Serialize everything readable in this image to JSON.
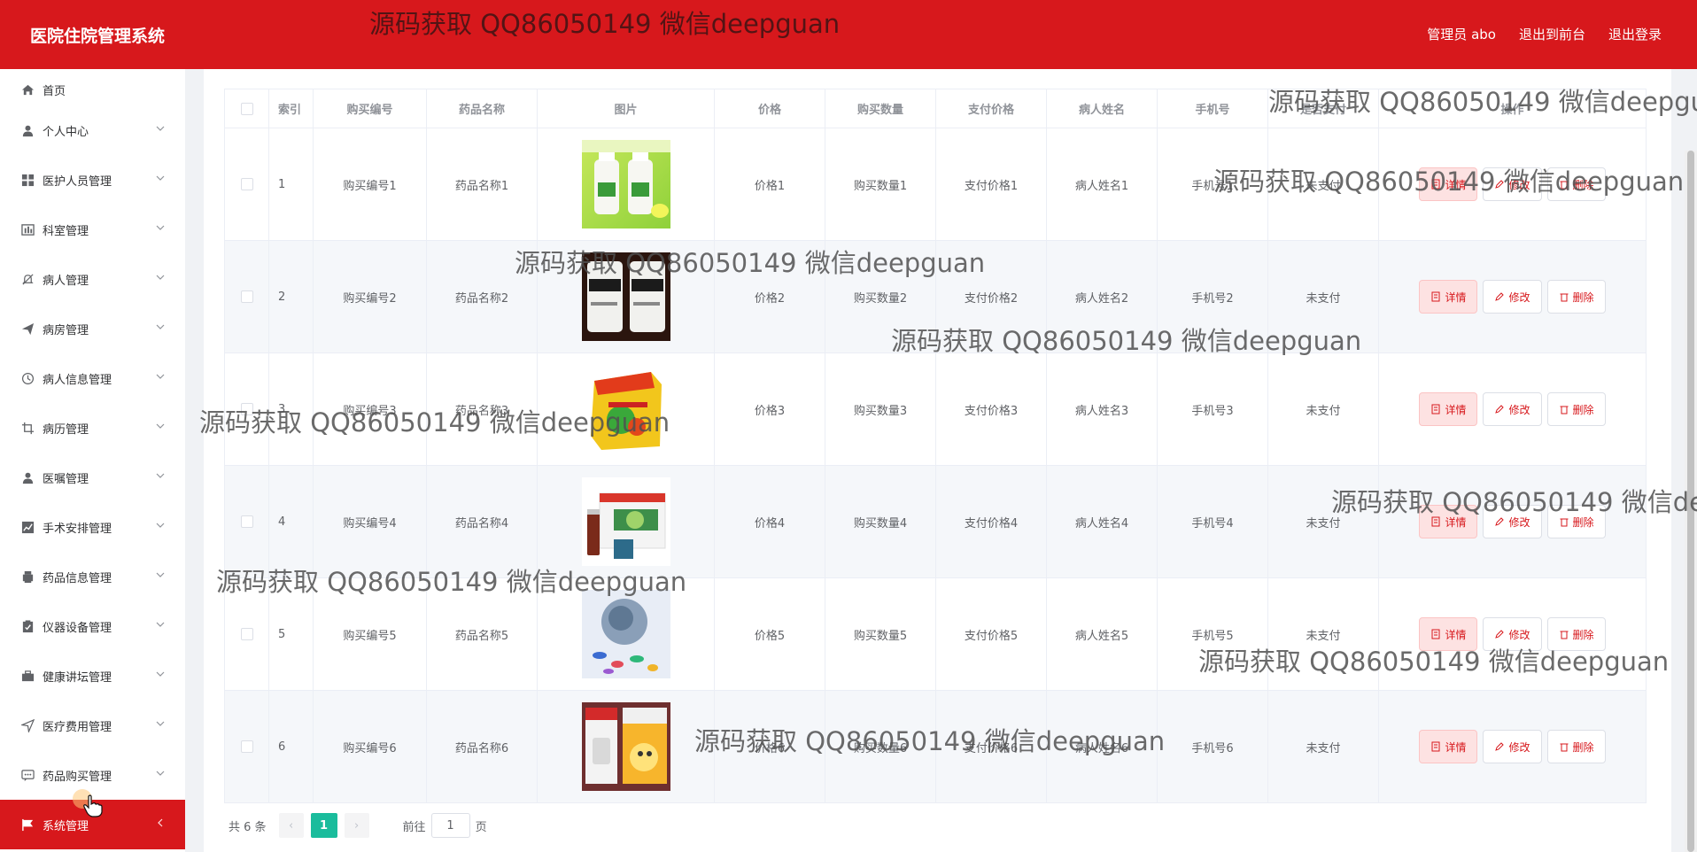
{
  "header": {
    "title": "医院住院管理系统",
    "user_label": "管理员 abo",
    "front_link": "退出到前台",
    "logout_link": "退出登录"
  },
  "sidebar": {
    "items": [
      {
        "label": "首页",
        "icon": "home-icon"
      },
      {
        "label": "个人中心",
        "icon": "user-icon"
      },
      {
        "label": "医护人员管理",
        "icon": "grid-icon"
      },
      {
        "label": "科室管理",
        "icon": "bar-chart-icon"
      },
      {
        "label": "病人管理",
        "icon": "bell-off-icon"
      },
      {
        "label": "病房管理",
        "icon": "send-icon"
      },
      {
        "label": "病人信息管理",
        "icon": "clock-icon"
      },
      {
        "label": "病历管理",
        "icon": "crop-icon"
      },
      {
        "label": "医嘱管理",
        "icon": "user-icon"
      },
      {
        "label": "手术安排管理",
        "icon": "trend-icon"
      },
      {
        "label": "药品信息管理",
        "icon": "printer-icon"
      },
      {
        "label": "仪器设备管理",
        "icon": "checklist-icon"
      },
      {
        "label": "健康讲坛管理",
        "icon": "briefcase-icon"
      },
      {
        "label": "医疗费用管理",
        "icon": "navigation-icon"
      },
      {
        "label": "药品购买管理",
        "icon": "message-icon"
      },
      {
        "label": "系统管理",
        "icon": "flag-icon"
      }
    ]
  },
  "table": {
    "columns": [
      "索引",
      "购买编号",
      "药品名称",
      "图片",
      "价格",
      "购买数量",
      "支付价格",
      "病人姓名",
      "手机号",
      "是否支付",
      "操作"
    ],
    "rows": [
      {
        "index": "1",
        "code": "购买编号1",
        "name": "药品名称1",
        "price": "价格1",
        "qty": "购买数量1",
        "pay": "支付价格1",
        "patient": "病人姓名1",
        "phone": "手机号1",
        "paid": "未支付"
      },
      {
        "index": "2",
        "code": "购买编号2",
        "name": "药品名称2",
        "price": "价格2",
        "qty": "购买数量2",
        "pay": "支付价格2",
        "patient": "病人姓名2",
        "phone": "手机号2",
        "paid": "未支付"
      },
      {
        "index": "3",
        "code": "购买编号3",
        "name": "药品名称3",
        "price": "价格3",
        "qty": "购买数量3",
        "pay": "支付价格3",
        "patient": "病人姓名3",
        "phone": "手机号3",
        "paid": "未支付"
      },
      {
        "index": "4",
        "code": "购买编号4",
        "name": "药品名称4",
        "price": "价格4",
        "qty": "购买数量4",
        "pay": "支付价格4",
        "patient": "病人姓名4",
        "phone": "手机号4",
        "paid": "未支付"
      },
      {
        "index": "5",
        "code": "购买编号5",
        "name": "药品名称5",
        "price": "价格5",
        "qty": "购买数量5",
        "pay": "支付价格5",
        "patient": "病人姓名5",
        "phone": "手机号5",
        "paid": "未支付"
      },
      {
        "index": "6",
        "code": "购买编号6",
        "name": "药品名称6",
        "price": "价格6",
        "qty": "购买数量6",
        "pay": "支付价格6",
        "patient": "病人姓名6",
        "phone": "手机号6",
        "paid": "未支付"
      }
    ],
    "actions": {
      "detail": "详情",
      "edit": "修改",
      "delete": "删除"
    }
  },
  "pager": {
    "total": "共 6 条",
    "current_page": "1",
    "goto_prefix": "前往",
    "goto_value": "1",
    "goto_suffix": "页"
  },
  "watermark": "源码获取 QQ86050149 微信deepguan",
  "colors": {
    "brand": "#d7181c",
    "pager_active": "#1abc9c"
  }
}
